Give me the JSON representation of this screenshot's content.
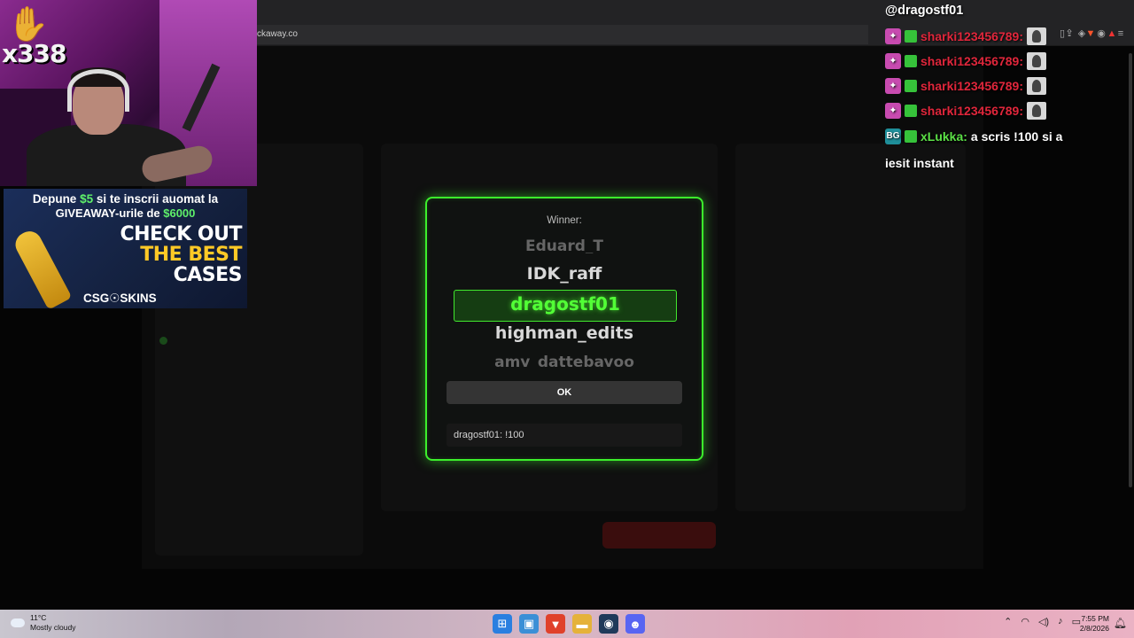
{
  "browser": {
    "url": "ckaway.co",
    "icons": [
      "share-icon",
      "brave-icon",
      "triangle-icon"
    ],
    "right_icons": [
      "music-icon",
      "sidebar-icon",
      "shield-icon",
      "extension-icon",
      "menu-icon"
    ]
  },
  "webcam": {
    "counter": "x338"
  },
  "ad": {
    "line1_pre": "Depune ",
    "line1_amount": "$5",
    "line1_post": " si te inscrii auomat la",
    "line2_pre": "GIVEAWAY-urile de ",
    "line2_amount": "$6000",
    "check": "CHECK OUT",
    "the_best": "THE BEST",
    "cases": "CASES",
    "brand": "CSG☉SKINS"
  },
  "chat": {
    "header": "@dragostf01",
    "lines": [
      {
        "user": "sharki123456789:",
        "badges": [
          "pink",
          "gift"
        ],
        "avatar": true
      },
      {
        "user": "sharki123456789:",
        "badges": [
          "pink",
          "gift"
        ],
        "avatar": true
      },
      {
        "user": "sharki123456789:",
        "badges": [
          "pink",
          "gift"
        ],
        "avatar": true
      },
      {
        "user": "sharki123456789:",
        "badges": [
          "pink",
          "gift"
        ],
        "avatar": true
      }
    ],
    "last": {
      "badge_text": "BG",
      "user": "xLukka:",
      "message": "a scris !100 si a",
      "message_wrap": "iesit instant"
    }
  },
  "modal": {
    "title": "Winner:",
    "names": {
      "fade_top": "Eduard_T",
      "above": "IDK_raff",
      "winner": "dragostf01",
      "below": "highman_edits",
      "fade_bottom": "amy_dattebayoo"
    },
    "ok_label": "OK",
    "message": "dragostf01: !100",
    "accent": "#3cf02c"
  },
  "taskbar": {
    "temp": "11°C",
    "condition": "Mostly cloudy",
    "time": "7:55 PM",
    "date": "2/8/2026",
    "notification_count": "1"
  }
}
